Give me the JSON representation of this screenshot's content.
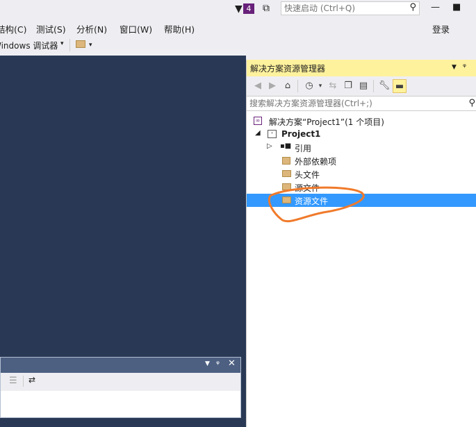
{
  "titlebar": {
    "notification_count": "4",
    "quick_launch_placeholder": "快速启动 (Ctrl+Q)",
    "minimize_glyph": "—",
    "maximize_glyph": "■"
  },
  "menu": {
    "items": [
      "结构(C)",
      "测试(S)",
      "分析(N)",
      "窗口(W)",
      "帮助(H)"
    ],
    "login": "登录"
  },
  "toolbar": {
    "debugger_target": "Windows 调试器"
  },
  "solution_explorer": {
    "title": "解决方案资源管理器",
    "search_placeholder": "搜索解决方案资源管理器(Ctrl+;)",
    "solution_label": "解决方案“Project1”(1 个项目)",
    "project_label": "Project1",
    "items": [
      {
        "label": "引用",
        "icon": "references-icon"
      },
      {
        "label": "外部依赖项",
        "icon": "external-deps-icon"
      },
      {
        "label": "头文件",
        "icon": "folder-icon"
      },
      {
        "label": "源文件",
        "icon": "folder-icon"
      },
      {
        "label": "资源文件",
        "icon": "folder-icon",
        "selected": true
      }
    ]
  },
  "colors": {
    "editor_bg": "#293955",
    "panel_title_active": "#fff29d",
    "selection": "#3399ff",
    "annotation": "#f07a2b"
  }
}
